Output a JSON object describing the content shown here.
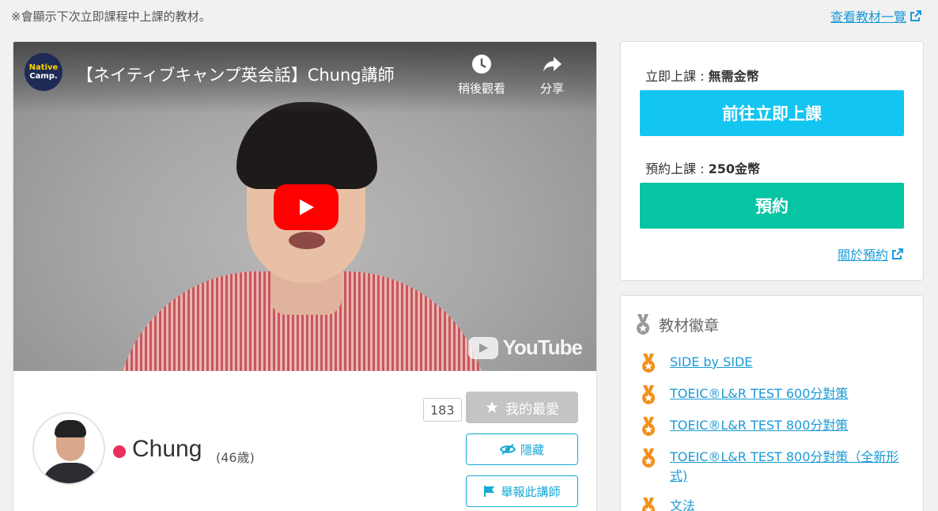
{
  "notice": "※會顯示下次立即課程中上課的教材。",
  "materials_link": "查看教材一覽",
  "video": {
    "channel_logo_line1": "Native",
    "channel_logo_line2": "Camp.",
    "title": "【ネイティブキャンプ英会話】Chung講師",
    "watch_later": "稍後觀看",
    "share": "分享",
    "youtube": "YouTube"
  },
  "teacher": {
    "name": "Chung",
    "age": "(46歲)",
    "status_color": "#e8305a",
    "favorite_count": "183",
    "favorite_label": "我的最愛",
    "hide_label": "隱藏",
    "report_label": "舉報此講師"
  },
  "booking": {
    "instant_label": "立即上課 : ",
    "instant_price": "無需金幣",
    "instant_button": "前往立即上課",
    "instant_color": "#13c5f1",
    "reserve_label": "預約上課 : ",
    "reserve_price": "250金幣",
    "reserve_button": "預約",
    "reserve_color": "#07c4a3",
    "about_link": "關於預約"
  },
  "badges": {
    "title": "教材徽章",
    "items": [
      "SIDE by SIDE",
      "TOEIC®L&R TEST 600分對策",
      "TOEIC®L&R TEST 800分對策",
      "TOEIC®L&R TEST 800分對策（全新形式)",
      "文法"
    ]
  }
}
